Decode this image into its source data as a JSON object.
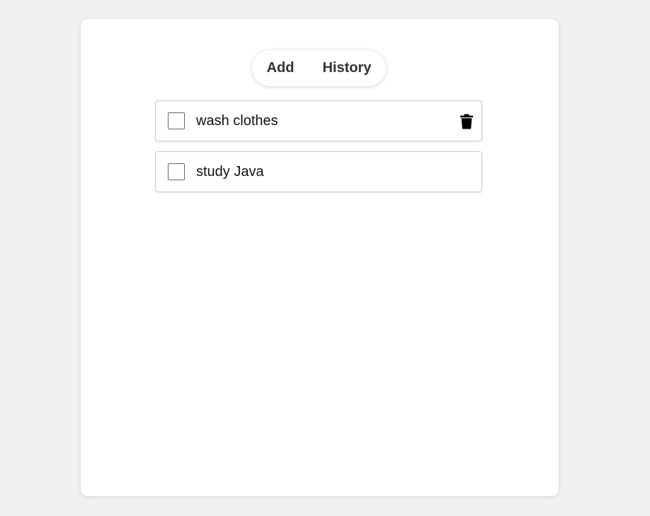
{
  "nav": {
    "add_label": "Add",
    "history_label": "History"
  },
  "tasks": [
    {
      "text": "wash clothes",
      "checked": false,
      "delete_icon": "trash-icon"
    },
    {
      "text": "study Java",
      "checked": false
    }
  ],
  "colors": {
    "background": "#f0f0f0",
    "card": "#ffffff",
    "nav_text": "#333333",
    "task_border": "#cccccc"
  }
}
